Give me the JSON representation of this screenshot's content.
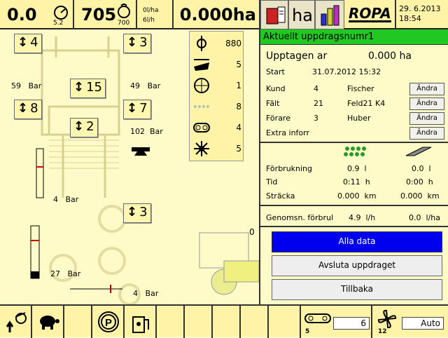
{
  "topbar": {
    "speed": "0.0",
    "speed_sub": "5.2",
    "rpm": "705",
    "rpm_sub": "700",
    "rate_ha": "0l/ha",
    "rate_h": "6l/h",
    "area": "0.000ha",
    "ha_label": "ha",
    "brand": "ROPA",
    "date": "29. 6.2013",
    "time": "18:54"
  },
  "left": {
    "boxes": [
      "4",
      "3",
      "15",
      "8",
      "7",
      "2",
      "3"
    ],
    "pressure_left": "59",
    "pressure_right": "49",
    "pressure_mid": "102",
    "gauge1_value": "4",
    "gauge2_value": "27",
    "gauge3_value": "4",
    "unit_bar": "Bar",
    "side_zero": "0"
  },
  "counters": [
    "880",
    "5",
    "1",
    "8",
    "4",
    "5"
  ],
  "order": {
    "title": "Aktuellt uppdragsnumr1",
    "taken_label": "Upptagen ar",
    "taken_value": "0.000 ha",
    "start_label": "Start",
    "start_value": "31.07.2012  15:32",
    "rows": [
      {
        "label": "Kund",
        "num": "4",
        "name": "Fischer",
        "btn": "Ändra"
      },
      {
        "label": "Fält",
        "num": "21",
        "name": "Feld21 K4",
        "btn": "Ändra"
      },
      {
        "label": "Förare",
        "num": "3",
        "name": "Huber",
        "btn": "Ändra"
      },
      {
        "label": "Extra inforr",
        "num": "",
        "name": "",
        "btn": "Ändra"
      }
    ],
    "consumption_label": "Förbrukning",
    "consumption_a": "0.9",
    "consumption_a_unit": "l",
    "consumption_b": "0.0",
    "consumption_b_unit": "l",
    "time_label": "Tid",
    "time_a": "0:11",
    "time_a_unit": "h",
    "time_b": "0:00",
    "time_b_unit": "h",
    "distance_label": "Sträcka",
    "distance_a": "0.000",
    "distance_a_unit": "km",
    "distance_b": "0.000",
    "distance_b_unit": "km",
    "avg_label": "Genomsn. förbrul",
    "avg_a": "4.9",
    "avg_a_unit": "l/h",
    "avg_b": "0.0",
    "avg_b_unit": "l/ha",
    "btn_all": "Alla data",
    "btn_finish": "Avsluta uppdraget",
    "btn_back": "Tillbaka"
  },
  "bottombar": {
    "chain_num": "5",
    "chain_value": "6",
    "fan_num": "12",
    "fan_value": "Auto",
    "colors": {
      "accent_blue": "#0000ee",
      "title_green": "#22c822"
    }
  }
}
